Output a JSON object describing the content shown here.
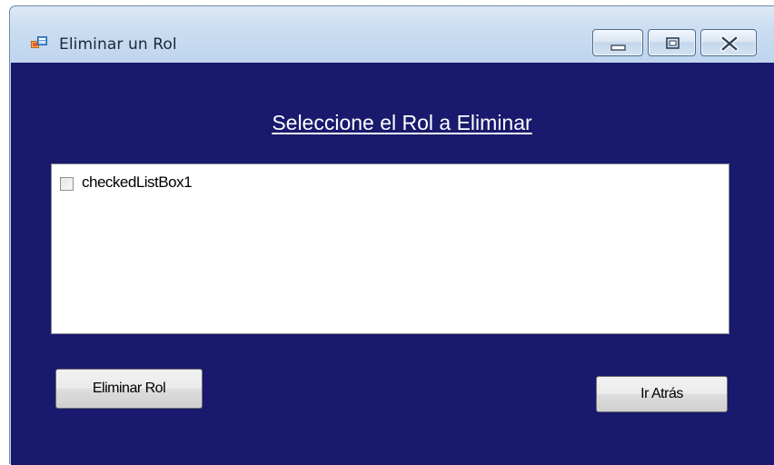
{
  "window": {
    "title": "Eliminar un Rol",
    "icon": "form-app-icon",
    "controls": [
      "minimize-icon",
      "maximize-icon",
      "close-icon"
    ]
  },
  "form": {
    "heading": "Seleccione el Rol a Eliminar",
    "background_color": "#19196d",
    "listbox": {
      "items": [
        {
          "label": "checkedListBox1",
          "checked": false
        }
      ]
    },
    "buttons": {
      "delete_label": "Eliminar Rol",
      "back_label": "Ir Atrás"
    }
  }
}
